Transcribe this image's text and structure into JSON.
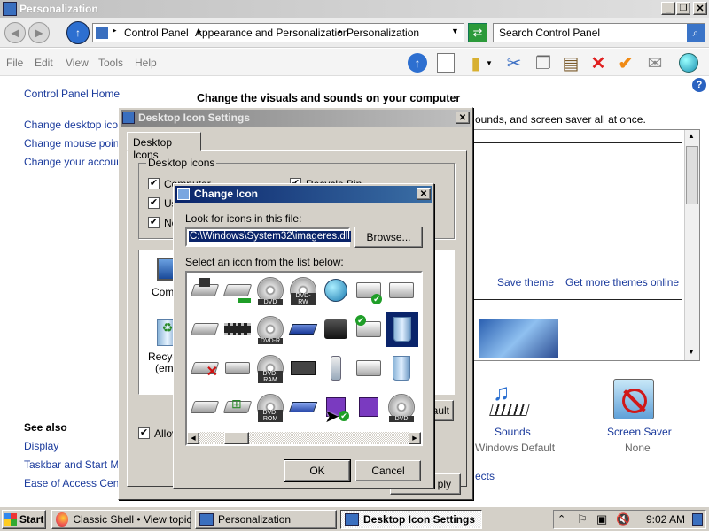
{
  "window": {
    "title": "Personalization"
  },
  "address": {
    "path": [
      "Control Panel",
      "Appearance and Personalization",
      "Personalization"
    ],
    "search_placeholder": "Search Control Panel"
  },
  "menu": [
    "File",
    "Edit",
    "View",
    "Tools",
    "Help"
  ],
  "left_nav": {
    "home": "Control Panel Home",
    "items": [
      "Change desktop icons",
      "Change mouse pointe",
      "Change your account"
    ],
    "see_also_title": "See also",
    "see_also": [
      "Display",
      "Taskbar and Start Men",
      "Ease of Access Cente"
    ]
  },
  "main": {
    "heading": "Change the visuals and sounds on your computer",
    "subtext": "ounds, and screen saver all at once.",
    "save_theme": "Save theme",
    "get_more": "Get more themes online",
    "sounds_label": "Sounds",
    "sounds_value": "Windows Default",
    "saver_label": "Screen Saver",
    "saver_value": "None",
    "partial_ects": "ects"
  },
  "desktop_icon_settings": {
    "title": "Desktop Icon Settings",
    "tab": "Desktop Icons",
    "group": "Desktop icons",
    "checks": [
      "Computer",
      "Us",
      "Ne",
      "Recycle Bin"
    ],
    "icon_labels": [
      "Comp",
      "Recyc",
      "(emp"
    ],
    "allow": "Allov",
    "default_btn": "ault",
    "apply_btn": "ply"
  },
  "change_icon": {
    "title": "Change Icon",
    "look_label": "Look for icons in this file:",
    "file_value": "C:\\Windows\\System32\\imageres.dll",
    "browse": "Browse...",
    "select_label": "Select an icon from the list below:",
    "ok": "OK",
    "cancel": "Cancel",
    "icons": [
      "drive",
      "drive-net",
      "cd-dvd",
      "cd-dvd-rw",
      "globe-network",
      "printer-check",
      "printer",
      "camera",
      "drive",
      "chip",
      "cd-dvd-r",
      "optical-disc",
      "camcorder",
      "printer-net",
      "recycle-bin",
      "",
      "drive-x",
      "drive-flat",
      "cd-dvd-ram",
      "tape-drive",
      "phone",
      "printer",
      "recycle-bin-empty",
      "lock",
      "drive",
      "windows-drive",
      "cd-dvd-rom",
      "drive-blue",
      "floppy-check",
      "floppy",
      "cd-dvd",
      ""
    ],
    "icon_texts": {
      "c2": "DVD",
      "c3": "DVD-RW",
      "c10": "DVD-R",
      "c18": "DVD-RAM",
      "c26": "DVD-ROM",
      "c30": "DVD"
    }
  },
  "taskbar": {
    "start": "Start",
    "items": [
      "Classic Shell • View topic ...",
      "Personalization",
      "Desktop Icon Settings"
    ],
    "time": "9:02 AM"
  },
  "colors": {
    "selection": "#0a246a",
    "titlebar": "#0a246a",
    "dialog": "#d4d0c8",
    "link": "#1a3a9c"
  }
}
